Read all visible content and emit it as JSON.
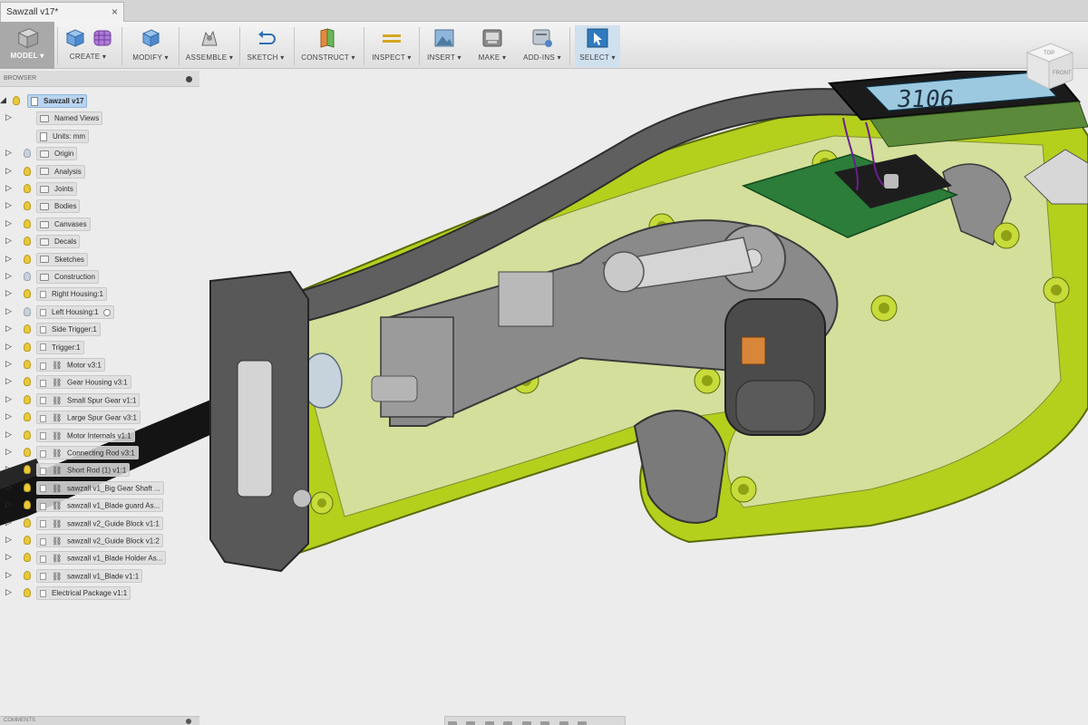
{
  "tab": {
    "title": "Sawzall v17*",
    "close": "×"
  },
  "toolbar": {
    "items": [
      {
        "label": "MODEL ▾"
      },
      {
        "label": "CREATE ▾"
      },
      {
        "label": "MODIFY ▾"
      },
      {
        "label": "ASSEMBLE ▾"
      },
      {
        "label": "SKETCH ▾"
      },
      {
        "label": "CONSTRUCT ▾"
      },
      {
        "label": "INSPECT ▾"
      },
      {
        "label": "INSERT ▾"
      },
      {
        "label": "MAKE ▾"
      },
      {
        "label": "ADD-INS ▾"
      },
      {
        "label": "SELECT ▾"
      }
    ],
    "colors": {
      "accent": "#2f7bbf",
      "model_bg": "#a9a9a9"
    }
  },
  "browser": {
    "header": "BROWSER",
    "root": "Sawzall v17",
    "items": [
      {
        "label": "Named Views",
        "icon": "folder",
        "arrow": true,
        "bulb": false
      },
      {
        "label": "Units: mm",
        "icon": "doc",
        "arrow": false,
        "bulb": false
      },
      {
        "label": "Origin",
        "icon": "folder",
        "arrow": true,
        "bulb": "dim"
      },
      {
        "label": "Analysis",
        "icon": "folder",
        "arrow": true,
        "bulb": "on"
      },
      {
        "label": "Joints",
        "icon": "folder",
        "arrow": true,
        "bulb": "on"
      },
      {
        "label": "Bodies",
        "icon": "folder",
        "arrow": true,
        "bulb": "on"
      },
      {
        "label": "Canvases",
        "icon": "folder",
        "arrow": true,
        "bulb": "on"
      },
      {
        "label": "Decals",
        "icon": "folder",
        "arrow": true,
        "bulb": "on"
      },
      {
        "label": "Sketches",
        "icon": "folder",
        "arrow": true,
        "bulb": "on"
      },
      {
        "label": "Construction",
        "icon": "folder",
        "arrow": true,
        "bulb": "dim"
      },
      {
        "label": "Right Housing:1",
        "icon": "cbox",
        "arrow": true,
        "bulb": "on"
      },
      {
        "label": "Left Housing:1",
        "icon": "cbox",
        "arrow": true,
        "bulb": "dim",
        "radio": true
      },
      {
        "label": "Side Trigger:1",
        "icon": "cbox",
        "arrow": true,
        "bulb": "on"
      },
      {
        "label": "Trigger:1",
        "icon": "cbox",
        "arrow": true,
        "bulb": "on"
      },
      {
        "label": "Motor v3:1",
        "icon": "link",
        "arrow": true,
        "bulb": "on"
      },
      {
        "label": "Gear Housing v3:1",
        "icon": "link",
        "arrow": true,
        "bulb": "on"
      },
      {
        "label": "Small Spur Gear v1:1",
        "icon": "link",
        "arrow": true,
        "bulb": "on"
      },
      {
        "label": "Large Spur Gear v3:1",
        "icon": "link",
        "arrow": true,
        "bulb": "on"
      },
      {
        "label": "Motor Internals v1:1",
        "icon": "link",
        "arrow": true,
        "bulb": "on"
      },
      {
        "label": "Connecting Rod v3:1",
        "icon": "link",
        "arrow": true,
        "bulb": "on"
      },
      {
        "label": "Short Rod (1) v1:1",
        "icon": "link",
        "arrow": true,
        "bulb": "on"
      },
      {
        "label": "sawzall v1_Big Gear Shaft ...",
        "icon": "link",
        "arrow": true,
        "bulb": "on"
      },
      {
        "label": "sawzall v1_Blade guard As...",
        "icon": "link",
        "arrow": true,
        "bulb": "on"
      },
      {
        "label": "sawzall v2_Guide Block v1:1",
        "icon": "link",
        "arrow": true,
        "bulb": "on"
      },
      {
        "label": "sawzall v2_Guide Block v1:2",
        "icon": "link",
        "arrow": true,
        "bulb": "on"
      },
      {
        "label": "sawzall v1_Blade Holder As...",
        "icon": "link",
        "arrow": true,
        "bulb": "on"
      },
      {
        "label": "sawzall v1_Blade v1:1",
        "icon": "link",
        "arrow": true,
        "bulb": "on"
      },
      {
        "label": "Electrical Package v1:1",
        "icon": "cbox",
        "arrow": true,
        "bulb": "on"
      }
    ]
  },
  "viewcube": {
    "top": "TOP",
    "front": "FRONT"
  },
  "lcd": {
    "reading": "3106"
  },
  "comments": {
    "label": "COMMENTS"
  }
}
